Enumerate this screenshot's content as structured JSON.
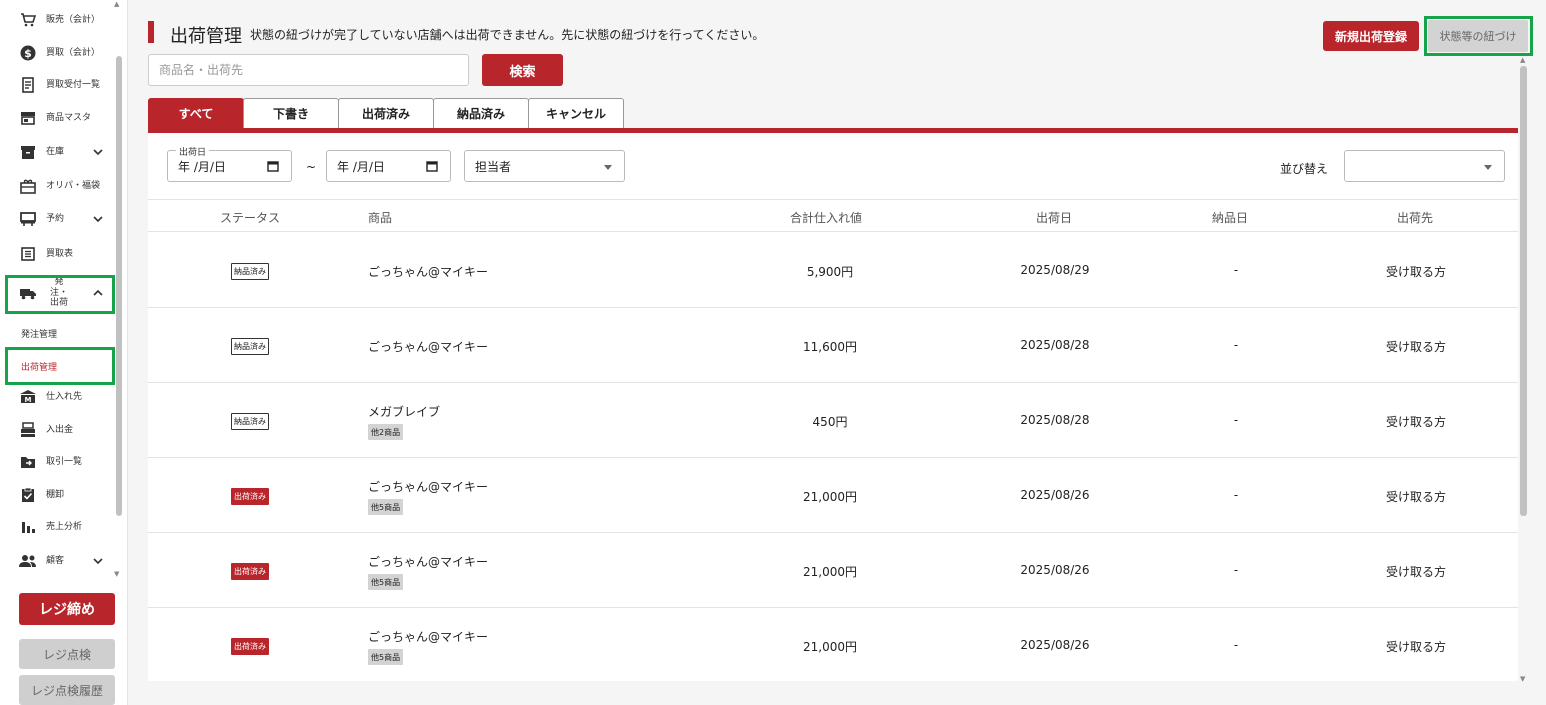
{
  "sidebar": {
    "items": [
      {
        "label": "販売（会計）",
        "icon": "cart-icon"
      },
      {
        "label": "買取（会計）",
        "icon": "dollar-icon"
      },
      {
        "label": "買取受付一覧",
        "icon": "receipt-icon"
      },
      {
        "label": "商品マスタ",
        "icon": "store-icon"
      },
      {
        "label": "在庫",
        "icon": "archive-icon"
      },
      {
        "label": "オリパ・福袋",
        "icon": "gift-icon"
      },
      {
        "label": "予約",
        "icon": "reservation-icon"
      },
      {
        "label": "買取表",
        "icon": "list-icon"
      },
      {
        "label": "発注・出荷",
        "icon": "truck-icon"
      },
      {
        "label": "仕入れ先",
        "icon": "supplier-icon"
      },
      {
        "label": "入出金",
        "icon": "register-icon"
      },
      {
        "label": "取引一覧",
        "icon": "folder-icon"
      },
      {
        "label": "棚卸",
        "icon": "clipboard-icon"
      },
      {
        "label": "売上分析",
        "icon": "chart-icon"
      },
      {
        "label": "顧客",
        "icon": "people-icon"
      }
    ],
    "sub_items": [
      "発注管理",
      "出荷管理"
    ],
    "close_button": "レジ締め",
    "check_button": "レジ点検",
    "history_button": "レジ点検履歴"
  },
  "header": {
    "title": "出荷管理",
    "note": "状態の紐づけが完了していない店舗へは出荷できません。先に状態の紐づけを行ってください。",
    "new_button": "新規出荷登録",
    "link_button": "状態等の紐づけ"
  },
  "search": {
    "placeholder": "商品名・出荷先",
    "button": "検索"
  },
  "tabs": [
    "すべて",
    "下書き",
    "出荷済み",
    "納品済み",
    "キャンセル"
  ],
  "filters": {
    "date_legend": "出荷日",
    "date_from": "年 /月/日",
    "date_to": "年 /月/日",
    "tilde": "~",
    "staff": "担当者",
    "sort_label": "並び替え"
  },
  "table": {
    "headers": [
      "ステータス",
      "商品",
      "合計仕入れ値",
      "出荷日",
      "納品日",
      "出荷先"
    ],
    "rows": [
      {
        "status": "納品済み",
        "status_type": "delivered",
        "product": "ごっちゃん@マイキー",
        "more": "",
        "total": "5,900円",
        "ship_date": "2025/08/29",
        "delivery_date": "-",
        "destination": "受け取る方"
      },
      {
        "status": "納品済み",
        "status_type": "delivered",
        "product": "ごっちゃん@マイキー",
        "more": "",
        "total": "11,600円",
        "ship_date": "2025/08/28",
        "delivery_date": "-",
        "destination": "受け取る方"
      },
      {
        "status": "納品済み",
        "status_type": "delivered",
        "product": "メガブレイブ",
        "more": "他2商品",
        "total": "450円",
        "ship_date": "2025/08/28",
        "delivery_date": "-",
        "destination": "受け取る方"
      },
      {
        "status": "出荷済み",
        "status_type": "shipped",
        "product": "ごっちゃん@マイキー",
        "more": "他5商品",
        "total": "21,000円",
        "ship_date": "2025/08/26",
        "delivery_date": "-",
        "destination": "受け取る方"
      },
      {
        "status": "出荷済み",
        "status_type": "shipped",
        "product": "ごっちゃん@マイキー",
        "more": "他5商品",
        "total": "21,000円",
        "ship_date": "2025/08/26",
        "delivery_date": "-",
        "destination": "受け取る方"
      },
      {
        "status": "出荷済み",
        "status_type": "shipped",
        "product": "ごっちゃん@マイキー",
        "more": "他5商品",
        "total": "21,000円",
        "ship_date": "2025/08/26",
        "delivery_date": "-",
        "destination": "受け取る方"
      }
    ]
  },
  "colors": {
    "accent": "#b8262b",
    "highlight": "#16a34a"
  }
}
